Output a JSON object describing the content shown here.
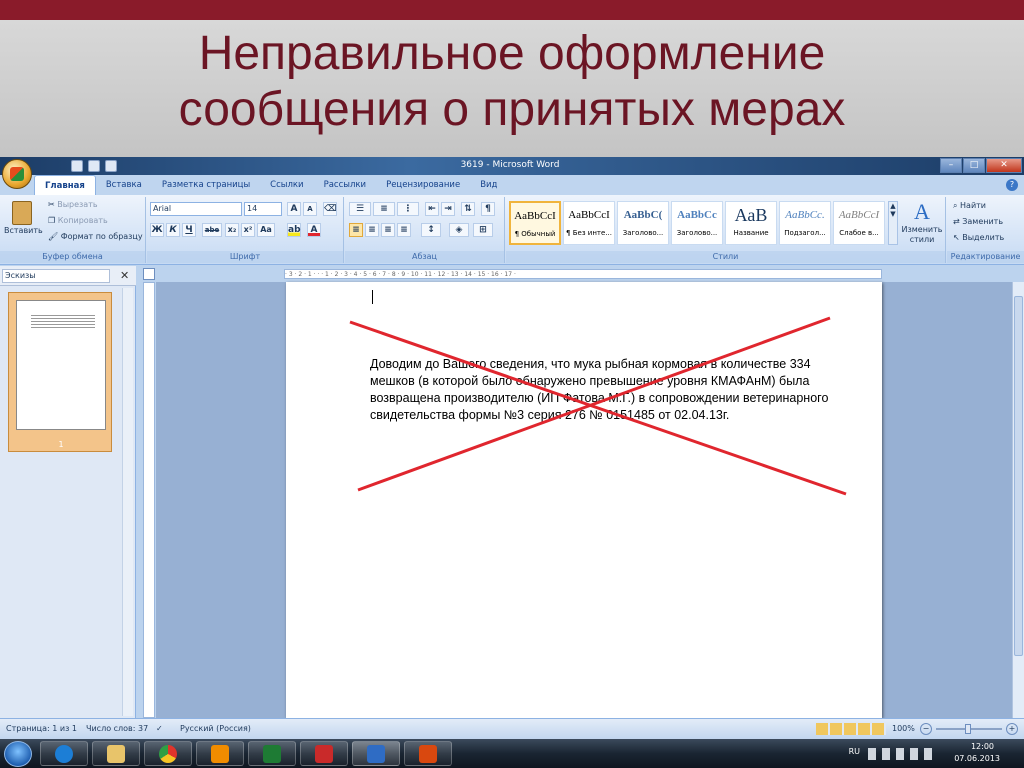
{
  "slide": {
    "title_line1": "Неправильное оформление",
    "title_line2": "сообщения о принятых мерах"
  },
  "window": {
    "title": "3619 - Microsoft Word",
    "controls": {
      "minimize": "–",
      "maximize": "□",
      "close": "✕"
    }
  },
  "ribbon": {
    "tabs": [
      "Главная",
      "Вставка",
      "Разметка страницы",
      "Ссылки",
      "Рассылки",
      "Рецензирование",
      "Вид"
    ],
    "clipboard": {
      "paste": "Вставить",
      "cut": "Вырезать",
      "copy": "Копировать",
      "format_painter": "Формат по образцу",
      "group_label": "Буфер обмена"
    },
    "font": {
      "family": "Arial",
      "size": "14",
      "bold": "Ж",
      "italic": "К",
      "underline": "Ч",
      "strike": "abe",
      "subscript": "x₂",
      "superscript": "x²",
      "case": "Aa",
      "group_label": "Шрифт"
    },
    "paragraph": {
      "group_label": "Абзац"
    },
    "styles": {
      "items": [
        {
          "preview": "AaBbCcI",
          "name": "¶ Обычный"
        },
        {
          "preview": "AaBbCcI",
          "name": "¶ Без инте..."
        },
        {
          "preview": "AaBbC(",
          "name": "Заголово..."
        },
        {
          "preview": "AaBbCc",
          "name": "Заголово..."
        },
        {
          "preview": "АаВ",
          "name": "Название"
        },
        {
          "preview": "AaBbCc.",
          "name": "Подзагол..."
        },
        {
          "preview": "AaBbCcI",
          "name": "Слабое в..."
        }
      ],
      "change_styles": "Изменить стили",
      "group_label": "Стили"
    },
    "editing": {
      "find": "Найти",
      "replace": "Заменить",
      "select": "Выделить",
      "group_label": "Редактирование"
    }
  },
  "navigation": {
    "pane_title": "Эскизы",
    "thumbnail_page": "1"
  },
  "document": {
    "body_text": "Доводим до Вашего сведения, что мука рыбная кормовая в количестве 334 мешков (в которой было обнаружено превышение уровня КМАФАнМ) была возвращена производителю (ИП Фатова М.Г.) в сопровождении ветеринарного свидетельства формы №3 серия 276 № 0151485 от 02.04.13г."
  },
  "statusbar": {
    "page": "Страница: 1 из 1",
    "words": "Число слов: 37",
    "language": "Русский (Россия)",
    "zoom": "100%"
  },
  "taskbar": {
    "lang": "RU",
    "time": "12:00",
    "date": "07.06.2013"
  },
  "colors": {
    "accent": "#8a1b2a",
    "title_text": "#6b1524",
    "cross": "#e0262e",
    "ribbon": "#c6daf3"
  }
}
